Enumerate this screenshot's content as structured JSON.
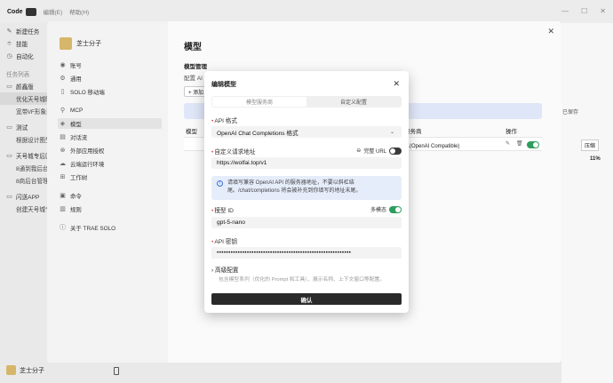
{
  "topbar": {
    "app": "Code",
    "menus": [
      "编辑(E)",
      "帮助(H)"
    ]
  },
  "app_sidebar": {
    "items": [
      {
        "icon": "edit-icon",
        "label": "新建任务"
      },
      {
        "icon": "bulb-icon",
        "label": "技能"
      },
      {
        "icon": "clock-icon",
        "label": "自动化"
      }
    ],
    "section": "任务列表",
    "groups": [
      {
        "label": "颜鑫版",
        "children": [
          "优化天号城映",
          "宽带I/F形象建"
        ]
      },
      {
        "label": "测试",
        "children": [
          "根据设计图生"
        ]
      },
      {
        "label": "天号城专后区",
        "children": [
          "8通到我后台管",
          "8商后台管理"
        ]
      },
      {
        "label": "闪送APP",
        "children": [
          "创建天号城专送"
        ]
      }
    ],
    "user": "芝士分子"
  },
  "settings": {
    "user": "芝士分子",
    "nav": [
      "账号",
      "通用",
      "SOLO 移动端",
      "MCP",
      "模型",
      "对话流",
      "外部应用授权",
      "云端运行环境",
      "工作树",
      "命令",
      "规则",
      "关于 TRAE SOLO"
    ],
    "title": "模型",
    "section": "模型管理",
    "desc": "配置 AI",
    "add": "+ 添加",
    "table_headers": [
      "模型",
      "服务商",
      "操作"
    ],
    "row": {
      "provider": "义(OpenAI Compatible)"
    },
    "right_labels": {
      "pct": "11%",
      "compress": "压缩",
      "save": "已保存"
    }
  },
  "modal": {
    "title": "编辑模型",
    "tabs": [
      "模型服务商",
      "自定义配置"
    ],
    "api_format_label": "API 格式",
    "api_format_value": "OpenAI Chat Completions 格式",
    "url_label": "自定义请求地址",
    "full_url_label": "完整 URL",
    "url_value": "https://wolfai.top/v1",
    "notice": "请填写兼容 OpenAI API 的服务器地址，不要以斜杠结尾。/chat/completions 将会被补充到你填写的地址末尾。",
    "model_id_label": "模型 ID",
    "multimodal_label": "多模态",
    "model_id_value": "gpt-5-nano",
    "api_key_label": "API 密钥",
    "api_key_value": "••••••••••••••••••••••••••••••••••••••••••••••••••••••••••",
    "advanced_label": "高级配置",
    "advanced_sub": "包含模型系列（优化的 Prompt 和工具）、展示名称、上下文窗口等配置。",
    "confirm": "确认"
  },
  "colors": {
    "accent": "#2e9e5f",
    "required": "#e54545",
    "info_bg": "#e6edfa"
  }
}
